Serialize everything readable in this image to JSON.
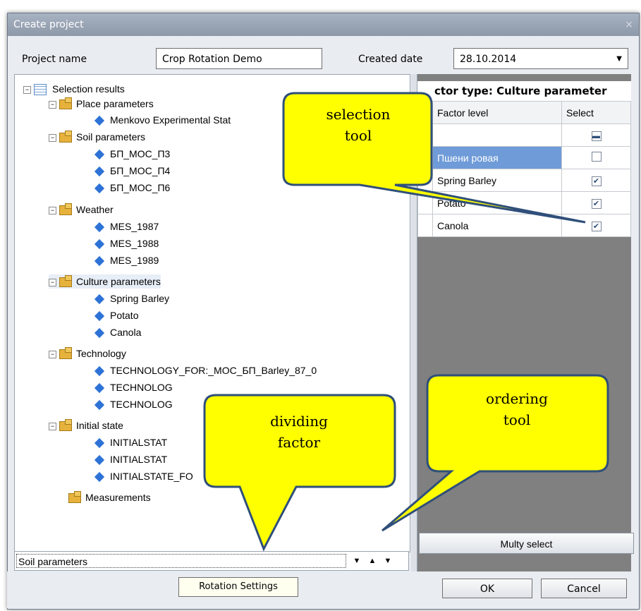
{
  "window": {
    "title": "Create project",
    "close_icon": "×"
  },
  "form": {
    "project_name_label": "Project name",
    "project_name_value": "Crop Rotation Demo",
    "created_date_label": "Created date",
    "created_date_value": "28.10.2014"
  },
  "tree": {
    "root": "Selection results",
    "place": "Place parameters",
    "place_items": [
      "Menkovo Experimental Stat"
    ],
    "soil": "Soil parameters",
    "soil_items": [
      "БП_МОС_П3",
      "БП_МОС_П4",
      "БП_МОС_П6"
    ],
    "weather": "Weather",
    "weather_items": [
      "MES_1987",
      "MES_1988",
      "MES_1989"
    ],
    "culture": "Culture parameters",
    "culture_items": [
      "Spring Barley",
      "Potato",
      "Canola"
    ],
    "technology": "Technology",
    "technology_items": [
      "TECHNOLOGY_FOR:_МОС_БП_Barley_87_0",
      "TECHNOLOG",
      "TECHNOLOG"
    ],
    "initial": "Initial state",
    "initial_items": [
      "INITIALSTAT",
      "INITIALSTAT",
      "INITIALSTATE_FO"
    ],
    "measurements": "Measurements"
  },
  "bottom": {
    "dividing_factor": "Soil parameters"
  },
  "right": {
    "factor_title": "ctor type: Culture parameter",
    "col_factor_level": "Factor level",
    "col_select": "Select",
    "rows": [
      {
        "label": "Пшени       ровая",
        "checked": false
      },
      {
        "label": "Spring Barley",
        "checked": true
      },
      {
        "label": "Potato",
        "checked": true
      },
      {
        "label": "Canola",
        "checked": true
      }
    ],
    "multy_select": "Multy select"
  },
  "footer": {
    "rotation_settings": "Rotation Settings",
    "ok": "OK",
    "cancel": "Cancel"
  },
  "callouts": {
    "selection_tool_1": "selection",
    "selection_tool_2": "tool",
    "dividing_factor_1": "dividing",
    "dividing_factor_2": "factor",
    "ordering_tool_1": "ordering",
    "ordering_tool_2": "tool"
  },
  "colors": {
    "callout_fill": "#ffff00",
    "callout_stroke": "#2f4f7a",
    "titlebar": "#9aa6b6"
  }
}
